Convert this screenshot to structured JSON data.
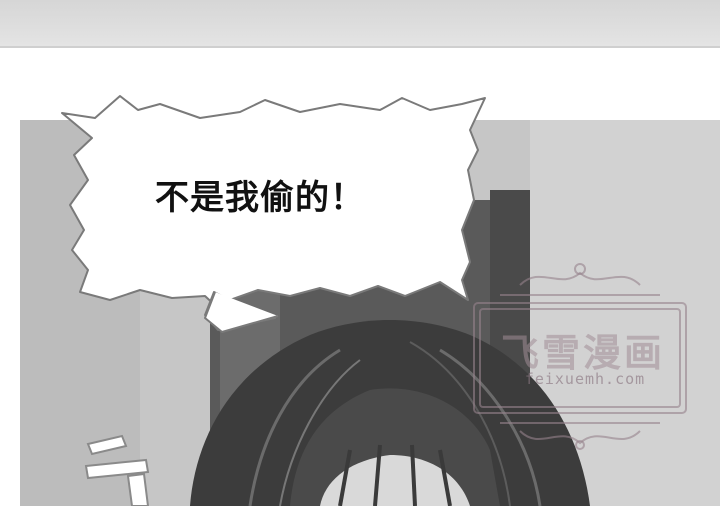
{
  "speech": {
    "text": "不是我偷的！"
  },
  "watermark": {
    "title": "飞雪漫画",
    "url": "feixuemh.com"
  },
  "colors": {
    "bubble_fill": "#ffffff",
    "bubble_outline": "#7a7a7a",
    "watermark": "#a08c96",
    "hair": "#3a3a3a"
  }
}
